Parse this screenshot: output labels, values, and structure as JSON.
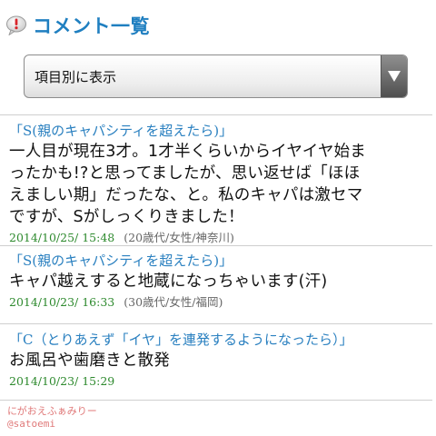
{
  "header": {
    "title": "コメント一覧",
    "icon": "speech-bubble-icon"
  },
  "sort_select": {
    "value": "項目別に表示"
  },
  "comments": [
    {
      "title": "「S(親のキャパシティを超えたら)」",
      "body": "一人目が現在3才。1才半くらいからイヤイヤ始ま\nったかも!?と思ってましたが、思い返せば「ほほ\nえましい期」だったな、と。私のキャパは激セマ\nですが、Sがしっくりきました！",
      "date": "2014/10/25/ 15:48",
      "author": "(20歳代/女性/神奈川)"
    },
    {
      "title": "「S(親のキャパシティを超えたら)」",
      "body": "キャパ越えすると地蔵になっちゃいます(汗)",
      "date": "2014/10/23/ 16:33",
      "author": "(30歳代/女性/福岡)"
    },
    {
      "title": "「C（とりあえず「イヤ」を連発するようになったら）」",
      "body": "お風呂や歯磨きと散発",
      "date": "2014/10/23/ 15:29",
      "author": ""
    }
  ],
  "watermark": {
    "line1": "にがおえふぁみりー",
    "line2": "@satoemi"
  },
  "colors": {
    "title_blue": "#1f7fc0",
    "comment_title_blue": "#2a80c0",
    "date_green": "#2e8a2e",
    "watermark_pink": "#e07a7a"
  }
}
